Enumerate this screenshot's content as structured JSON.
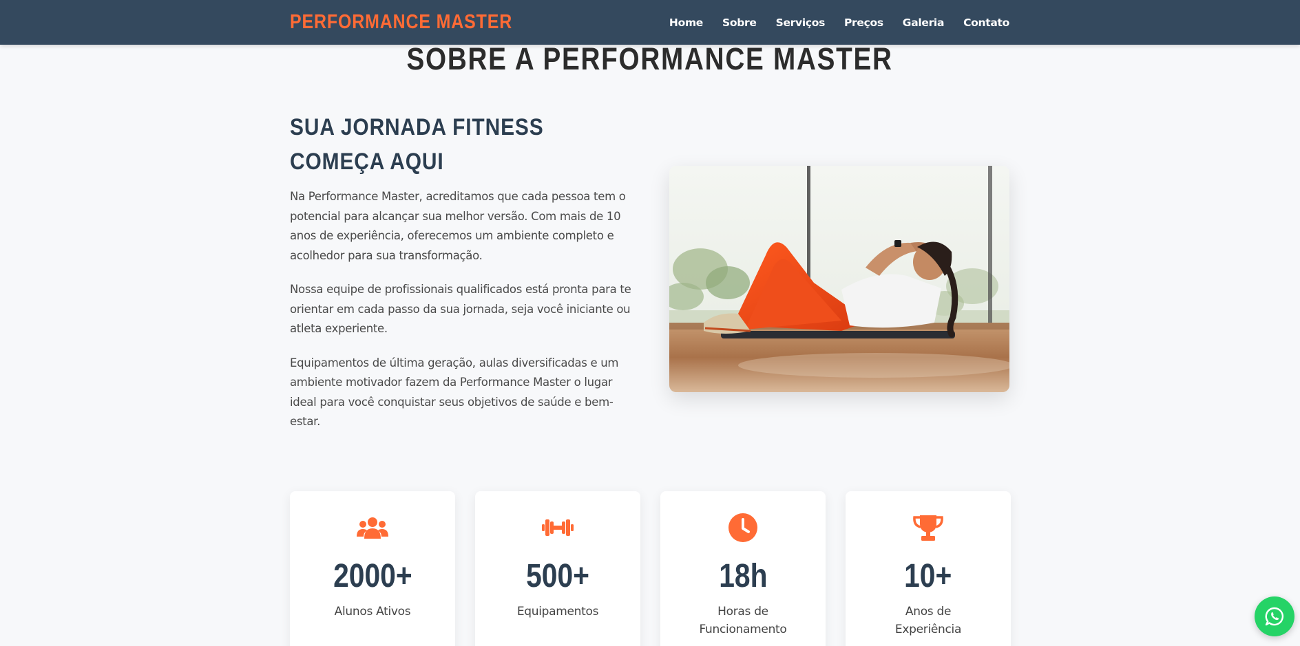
{
  "nav": {
    "brand": "PERFORMANCE MASTER",
    "links": [
      "Home",
      "Sobre",
      "Serviços",
      "Preços",
      "Galeria",
      "Contato"
    ]
  },
  "about": {
    "title": "SOBRE A PERFORMANCE MASTER",
    "subheading": "SUA JORNADA FITNESS COMEÇA AQUI",
    "paragraphs": [
      "Na Performance Master, acreditamos que cada pessoa tem o potencial para alcançar sua melhor versão. Com mais de 10 anos de experiência, oferecemos um ambiente completo e acolhedor para sua transformação.",
      "Nossa equipe de profissionais qualificados está pronta para te orientar em cada passo da sua jornada, seja você iniciante ou atleta experiente.",
      "Equipamentos de última geração, aulas diversificadas e um ambiente motivador fazem da Performance Master o lugar ideal para você conquistar seus objetivos de saúde e bem-estar."
    ]
  },
  "stats": [
    {
      "icon": "users-icon",
      "number": "2000+",
      "label": "Alunos Ativos"
    },
    {
      "icon": "dumbbell-icon",
      "number": "500+",
      "label": "Equipamentos"
    },
    {
      "icon": "clock-icon",
      "number": "18h",
      "label": "Horas de Funcionamento"
    },
    {
      "icon": "trophy-icon",
      "number": "10+",
      "label": "Anos de Experiência"
    }
  ],
  "colors": {
    "accent": "#ff6b35",
    "navbar": "#34495e",
    "heading": "#2c3e50",
    "whatsapp": "#25d366"
  },
  "whatsapp_icon": "whatsapp-icon"
}
